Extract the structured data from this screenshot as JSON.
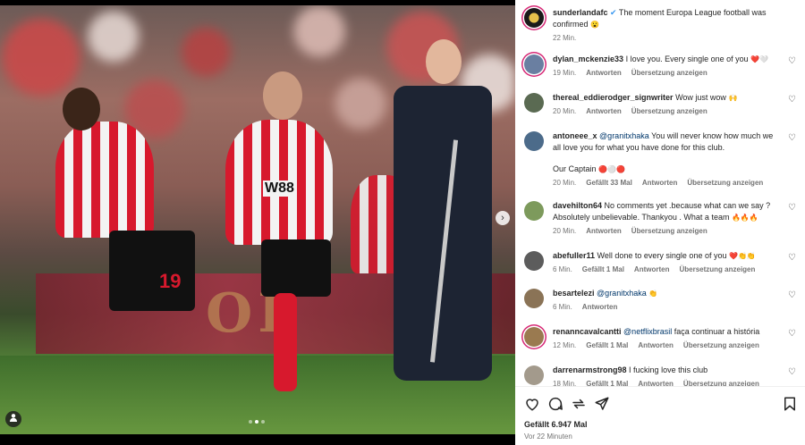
{
  "post": {
    "author": "sunderlandafc",
    "caption": "The moment Europa League football was confirmed",
    "caption_emoji": "😮",
    "time": "22 Min.",
    "jersey_sponsor": "W88",
    "player_number": "19",
    "board_text": "OL"
  },
  "labels": {
    "reply": "Antworten",
    "translate": "Übersetzung anzeigen"
  },
  "comments": [
    {
      "user": "dylan_mckenzie33",
      "text": "I love you. Every single one of you",
      "emoji": "❤️🤍",
      "time": "19 Min.",
      "likes": "",
      "translate": true
    },
    {
      "user": "thereal_eddierodger_signwriter",
      "text": "Wow just wow",
      "emoji": "🙌",
      "time": "20 Min.",
      "likes": "",
      "translate": true
    },
    {
      "user": "antoneee_x",
      "mention": "@granitxhaka",
      "text": "You will never know how much we all love you for what you have done for this club.",
      "text2": "Our Captain",
      "emoji": "🔴⚪🔴",
      "time": "20 Min.",
      "likes": "Gefällt 33 Mal",
      "translate": true
    },
    {
      "user": "davehilton64",
      "text": "No comments yet .because what can we say ? Absolutely unbelievable. Thankyou . What a team",
      "emoji": "🔥🔥🔥",
      "time": "20 Min.",
      "likes": "",
      "translate": true
    },
    {
      "user": "abefuller11",
      "text": "Well done to every single one of you",
      "emoji": "❤️👏👏",
      "time": "6 Min.",
      "likes": "Gefällt 1 Mal",
      "translate": true
    },
    {
      "user": "besartelezi",
      "mention": "@granitxhaka",
      "text": "",
      "emoji": "👏",
      "time": "6 Min.",
      "likes": "",
      "translate": false
    },
    {
      "user": "renanncavalcantti",
      "mention": "@netflixbrasil",
      "text": "faça continuar a história",
      "emoji": "",
      "time": "12 Min.",
      "likes": "Gefällt 1 Mal",
      "translate": true
    },
    {
      "user": "darrenarmstrong98",
      "text": "I fucking love this club",
      "emoji": "",
      "time": "18 Min.",
      "likes": "Gefällt 1 Mal",
      "translate": true
    }
  ],
  "footer": {
    "likes": "Gefällt 6.947 Mal",
    "ago": "Vor 22 Minuten"
  },
  "icons": [
    "heart-icon",
    "comment-icon",
    "share-icon",
    "send-icon",
    "bookmark-icon",
    "chevron-right-icon",
    "user-tag-icon"
  ],
  "colors": {
    "mention": "#00376b",
    "story_ring": "#d62976",
    "muted": "#737373"
  }
}
